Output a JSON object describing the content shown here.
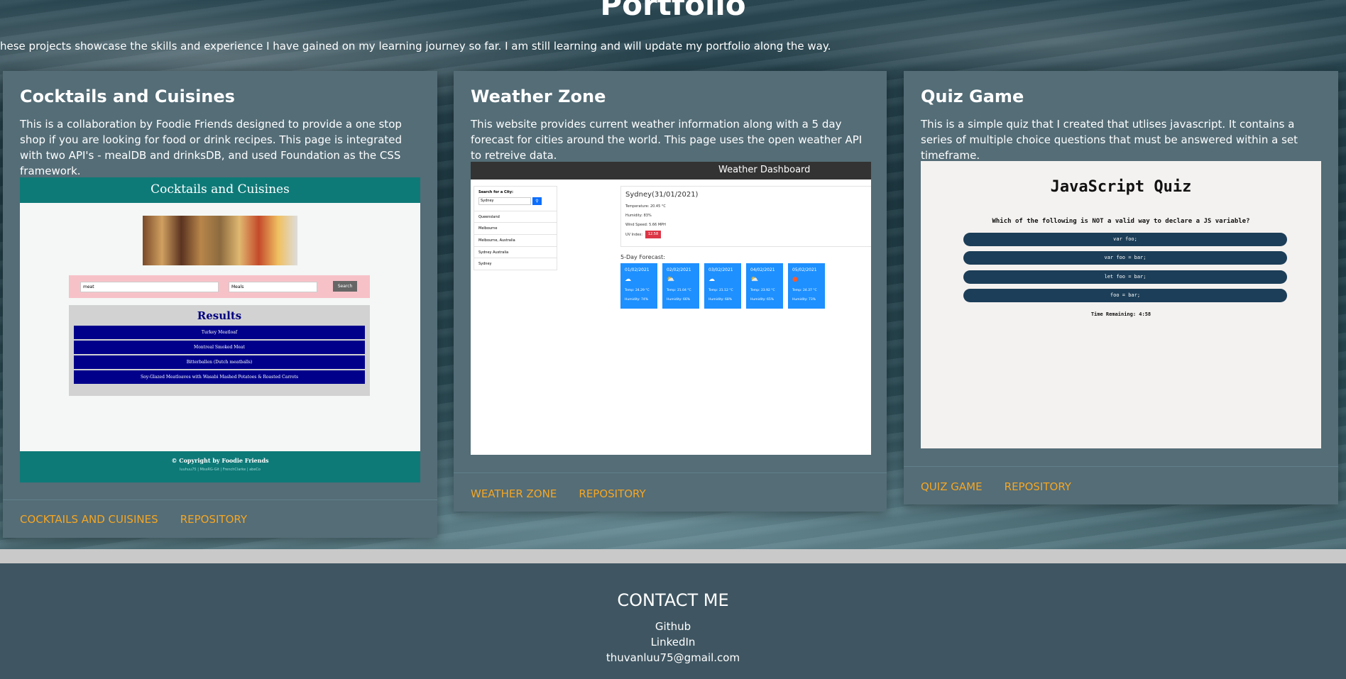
{
  "header": {
    "title": "Portfolio",
    "intro": "hese projects showcase the skills and experience I have gained on my learning journey so far. I am still learning and will update my portfolio along the way."
  },
  "projects": [
    {
      "title": "Cocktails and Cuisines",
      "description": "This is a collaboration by Foodie Friends designed to provide a one stop shop if you are looking for food or drink recipes. This page is integrated with two API's - mealDB and drinksDB, and used Foundation as the CSS framework.",
      "link_label": "COCKTAILS AND CUISINES",
      "repo_label": "REPOSITORY",
      "screenshot": {
        "header": "Cocktails and Cuisines",
        "search_value": "meat",
        "select_value": "Meals",
        "search_button": "Search",
        "results_title": "Results",
        "results": [
          "Turkey Meatloaf",
          "Montreal Smoked Meat",
          "Bitterballen (Dutch meatballs)",
          "Soy-Glazed Meatloaves with Wasabi Mashed Potatoes & Roasted Carrots"
        ],
        "copyright": "© Copyright by Foodie Friends",
        "footer_links": "luuhuu75 | MissRG-Git | FrenchClarke | abeCo"
      }
    },
    {
      "title": "Weather Zone",
      "description": "This website provides current weather information along with a 5 day forecast for cities around the world. This page uses the open weather API to retreive data.",
      "link_label": "WEATHER ZONE",
      "repo_label": "REPOSITORY",
      "screenshot": {
        "header": "Weather Dashboard",
        "search_label": "Search for a City:",
        "search_value": "Sydney",
        "cities": [
          "Queensland",
          "Melbourne",
          "Melbourne, Australia",
          "Sydney Australia",
          "Sydney"
        ],
        "city_title": "Sydney(31/01/2021)",
        "temperature": "Temperature: 20.45 °C",
        "humidity": "Humidity: 83%",
        "wind": "Wind Speed: 5.66 MPH",
        "uv_label": "UV Index:",
        "uv_value": "12.58",
        "forecast_title": "5-Day Forecast:",
        "forecast": [
          {
            "date": "01/02/2021",
            "icon": "☁",
            "temp": "Temp: 24.29 °C",
            "humidity": "Humidity: 74%"
          },
          {
            "date": "02/02/2021",
            "icon": "⛅",
            "temp": "Temp: 21.04 °C",
            "humidity": "Humidity: 66%"
          },
          {
            "date": "03/02/2021",
            "icon": "☁",
            "temp": "Temp: 21.12 °C",
            "humidity": "Humidity: 68%"
          },
          {
            "date": "04/02/2021",
            "icon": "⛅",
            "temp": "Temp: 23.92 °C",
            "humidity": "Humidity: 65%"
          },
          {
            "date": "05/02/2021",
            "icon": "●",
            "temp": "Temp: 24.37 °C",
            "humidity": "Humidity: 73%"
          }
        ]
      }
    },
    {
      "title": "Quiz Game",
      "description": "This is a simple quiz that I created that utlises javascript. It contains a series of multiple choice questions that must be answered within a set timeframe.",
      "link_label": "QUIZ GAME",
      "repo_label": "REPOSITORY",
      "screenshot": {
        "title": "JavaScript Quiz",
        "question": "Which of the following is NOT a valid way to declare a JS variable?",
        "options": [
          "var foo;",
          "var foo = bar;",
          "let foo = bar;",
          "foo = bar;"
        ],
        "timer": "Time Remaining: 4:58"
      }
    }
  ],
  "contact": {
    "title": "CONTACT ME",
    "links": [
      "Github",
      "LinkedIn",
      "thuvanluu75@gmail.com"
    ]
  },
  "colors": {
    "card_bg": "#546d77",
    "link": "#f5a623",
    "footer_bg": "#3f5662"
  }
}
